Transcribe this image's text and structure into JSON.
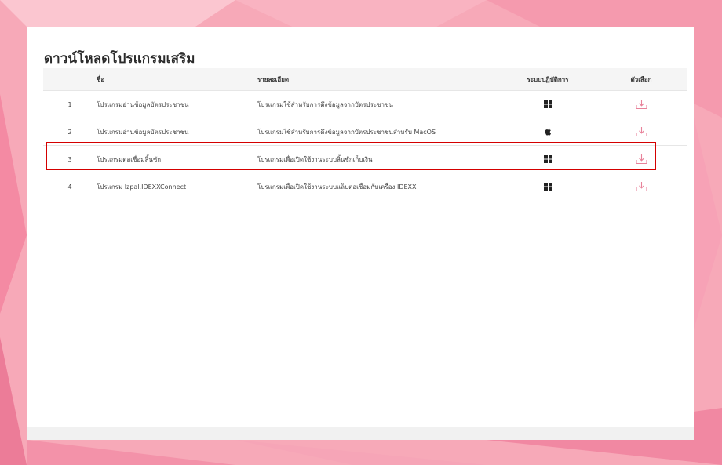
{
  "page": {
    "title": "ดาวน์โหลดโปรแกรมเสริม"
  },
  "table": {
    "headers": {
      "no": "",
      "name": "ชื่อ",
      "description": "รายละเอียด",
      "os": "ระบบปฏิบัติการ",
      "action": "ตัวเลือก"
    },
    "rows": [
      {
        "no": "1",
        "name": "โปรแกรมอ่านข้อมูลบัตรประชาชน",
        "description": "โปรแกรมใช้สำหรับการดึงข้อมูลจากบัตรประชาชน",
        "os_icon": "windows-icon",
        "action_icon": "download-icon"
      },
      {
        "no": "2",
        "name": "โปรแกรมอ่านข้อมูลบัตรประชาชน",
        "description": "โปรแกรมใช้สำหรับการดึงข้อมูลจากบัตรประชาชนสำหรับ MacOS",
        "os_icon": "apple-icon",
        "action_icon": "download-icon"
      },
      {
        "no": "3",
        "name": "โปรแกรมต่อเชื่อมลิ้นชัก",
        "description": "โปรแกรมเพื่อเปิดใช้งานระบบลิ้นชักเก็บเงิน",
        "os_icon": "windows-icon",
        "action_icon": "download-icon"
      },
      {
        "no": "4",
        "name": "โปรแกรม Izpal.IDEXXConnect",
        "description": "โปรแกรมเพื่อเปิดใช้งานระบบแล็บต่อเชื่อมกับเครื่อง IDEXX",
        "os_icon": "windows-icon",
        "action_icon": "download-icon"
      }
    ]
  },
  "colors": {
    "background": "#f7a9b8",
    "download_icon": "#e8829a",
    "highlight_border": "#d40000"
  },
  "highlighted_row": "3"
}
